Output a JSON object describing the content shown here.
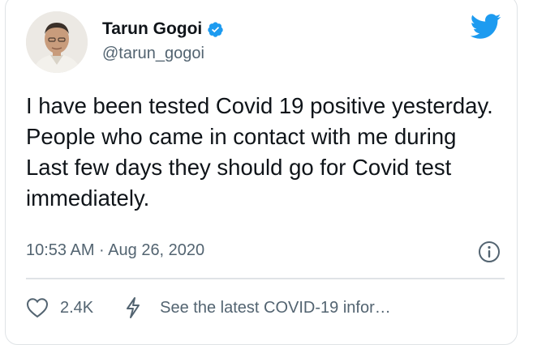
{
  "author": {
    "display_name": "Tarun Gogoi",
    "handle": "@tarun_gogoi",
    "verified": true,
    "avatar_icon": "profile-photo"
  },
  "tweet": {
    "text": "I have been tested Covid 19 positive yesterday. People who came in contact with me during Last few days they should go for Covid test immediately.",
    "timestamp": "10:53 AM · Aug 26, 2020"
  },
  "actions": {
    "like_count": "2.4K",
    "covid_link": "See the latest COVID-19 infor…"
  },
  "icons": {
    "brand": "twitter-bird-icon",
    "verified": "verified-badge-icon",
    "info": "info-icon",
    "like": "heart-icon",
    "covid": "lightning-bolt-icon"
  },
  "colors": {
    "brand_blue": "#1d9bf0",
    "text_primary": "#0f1419",
    "text_secondary": "#536471",
    "border": "#dfe3e6"
  }
}
